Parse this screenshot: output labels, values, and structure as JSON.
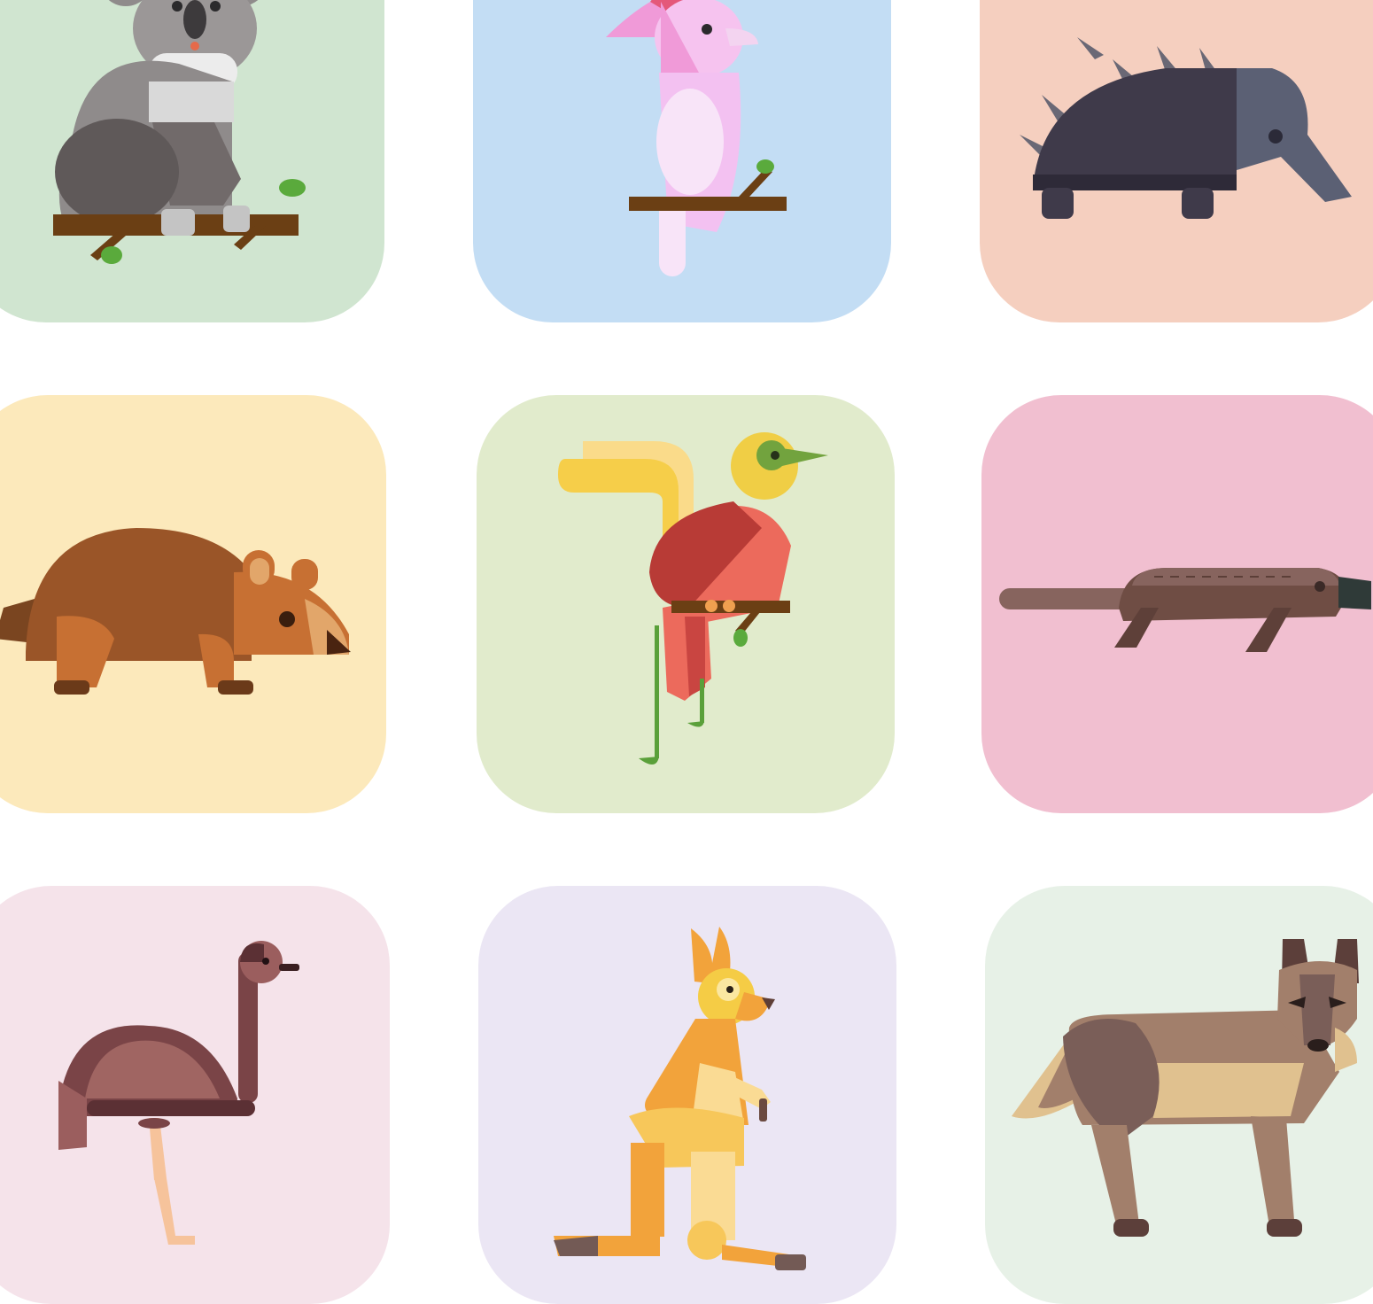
{
  "tiles": [
    {
      "icon": "koala-icon",
      "bg": "#d0e5d0"
    },
    {
      "icon": "cockatoo-icon",
      "bg": "#c3ddf4"
    },
    {
      "icon": "echidna-icon",
      "bg": "#f5cfbf"
    },
    {
      "icon": "wombat-icon",
      "bg": "#fce9bb"
    },
    {
      "icon": "bird-of-paradise-icon",
      "bg": "#e1ebcc"
    },
    {
      "icon": "platypus-icon",
      "bg": "#f1bfd0"
    },
    {
      "icon": "emu-icon",
      "bg": "#f5e3ea"
    },
    {
      "icon": "kangaroo-icon",
      "bg": "#ebe6f4"
    },
    {
      "icon": "dingo-icon",
      "bg": "#e7f1e7"
    }
  ],
  "colors": {
    "branch": "#6b3f14",
    "leaf": "#5aaa3c",
    "page_background": "#ffffff"
  }
}
